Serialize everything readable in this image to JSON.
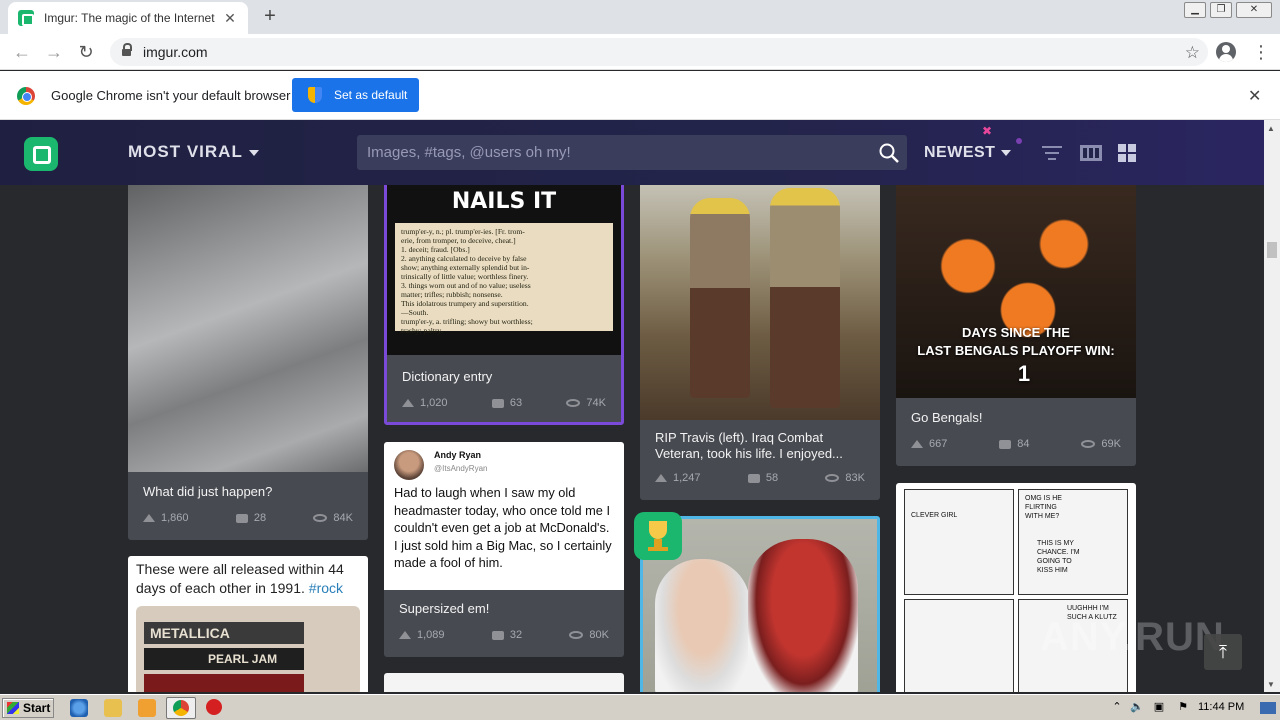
{
  "browser": {
    "tab_title": "Imgur: The magic of the Internet",
    "tab_close": "✕",
    "new_tab": "+",
    "url": "imgur.com",
    "infobar_text": "Google Chrome isn't your default browser",
    "set_default_label": "Set as default",
    "infobar_close": "✕",
    "back": "←",
    "forward": "→",
    "reload": "↻",
    "star": "☆",
    "menu": "⋮",
    "win_min": "▁",
    "win_max": "❐",
    "win_close": "✕"
  },
  "imgur": {
    "section": "MOST VIRAL",
    "search_placeholder": "Images, #tags, @users oh my!",
    "sort": "NEWEST"
  },
  "posts": [
    {
      "title": "What did just happen?",
      "ups": "1,860",
      "comments": "28",
      "views": "84K"
    },
    {
      "title": "Dictionary entry",
      "ups": "1,020",
      "comments": "63",
      "views": "74K",
      "image_text": "NAILS IT",
      "dict_lines": [
        "trump'er-y, n.; pl. trump'er-ies. [Fr. trom-",
        "erie, from tromper, to deceive, cheat.]",
        "1. deceit; fraud. [Obs.]",
        "2. anything calculated to deceive by false",
        "show; anything externally splendid but in-",
        "trinsically of little value; worthless finery.",
        "3. things worn out and of no value; useless",
        "matter; trifles; rubbish; nonsense.",
        "This idolatrous trumpery and superstition.",
        "—South.",
        "trump'er-y, a. trifling; showy but worthless;",
        "trashy; paltry."
      ]
    },
    {
      "title": "RIP Travis (left). Iraq Combat Veteran, took his life. I enjoyed...",
      "ups": "1,247",
      "comments": "58",
      "views": "83K"
    },
    {
      "title": "Go Bengals!",
      "ups": "667",
      "comments": "84",
      "views": "69K",
      "image_line1": "DAYS SINCE THE",
      "image_line2": "LAST BENGALS PLAYOFF WIN:",
      "image_number": "1"
    },
    {
      "title": "Supersized em!",
      "ups": "1,089",
      "comments": "32",
      "views": "80K",
      "tweet_name": "Andy Ryan",
      "tweet_handle": "@ItsAndyRyan",
      "tweet_text": "Had to laugh when I saw my old headmaster today, who once told me I couldn't even get a job at McDonald's. I just sold him a Big Mac, so I certainly made a fool of him."
    },
    {
      "caption_text": "These were all released within 44 days of each other in 1991. ",
      "caption_tag": "#rock",
      "tape1": "METALLICA",
      "tape2": "PEARL JAM"
    },
    {
      "comic_lines": [
        "CLEVER GIRL",
        "OMG IS HE FLIRTING WITH ME?",
        "THIS IS MY CHANCE. I'M GOING TO KISS HIM",
        "UUGHHH I'M SUCH A KLUTZ"
      ]
    }
  ],
  "taskbar": {
    "start": "Start",
    "clock": "11:44 PM"
  },
  "watermark": "ANY.RUN",
  "to_top": "⤒"
}
